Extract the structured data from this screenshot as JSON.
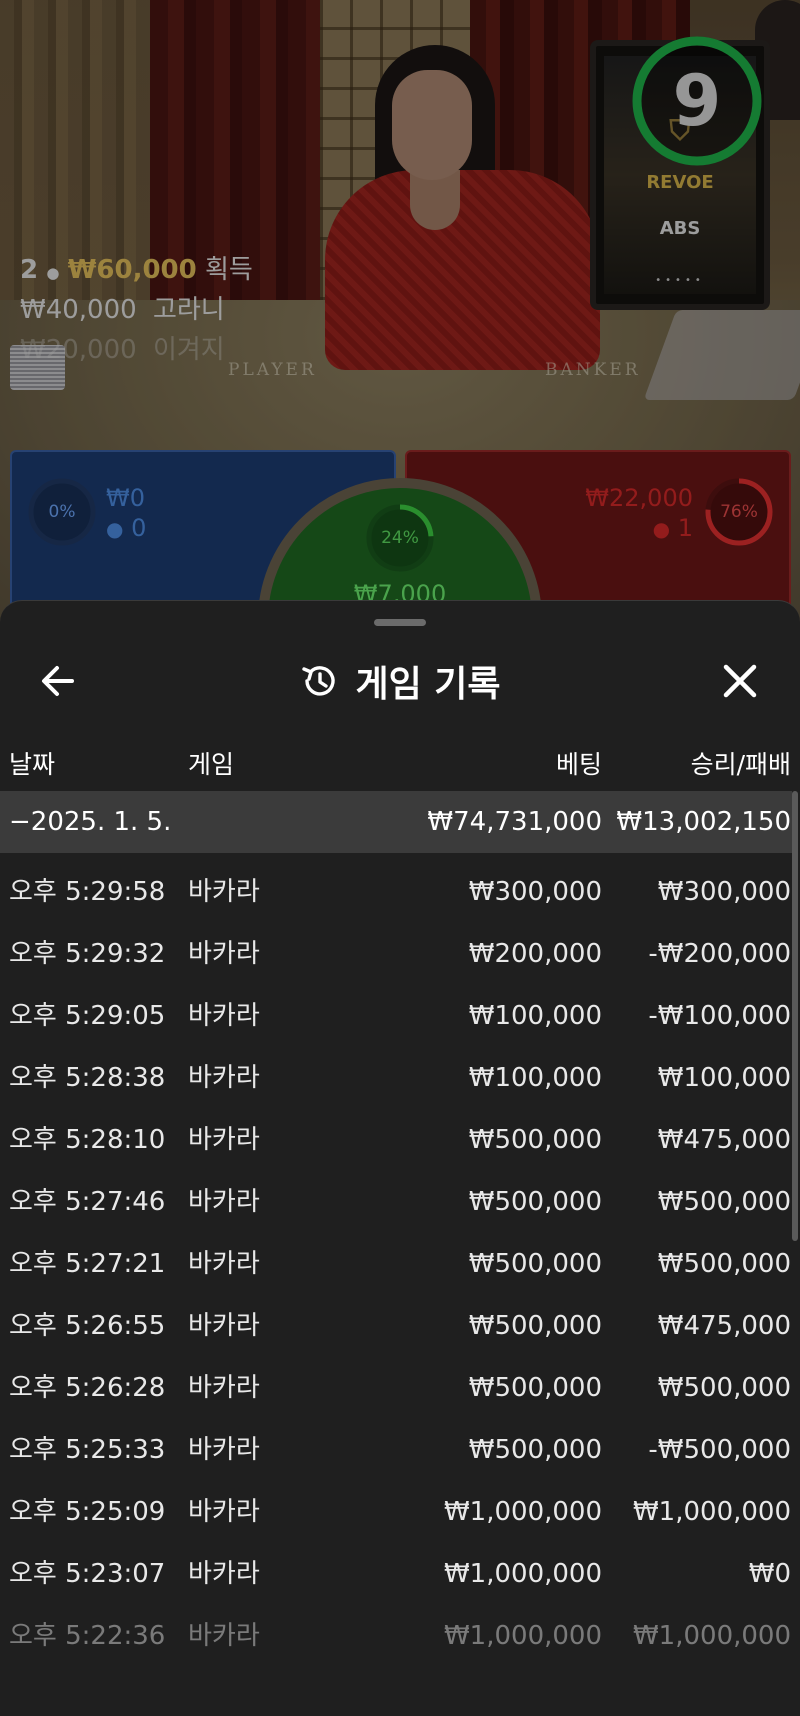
{
  "live": {
    "timer": "9",
    "ticker": [
      {
        "count": "2",
        "amount": "₩60,000",
        "action": "획득"
      },
      {
        "amount": "₩40,000",
        "name": "고라니"
      },
      {
        "amount": "₩20,000",
        "name": "이겨지"
      }
    ],
    "table_labels": {
      "player": "PLAYER",
      "banker": "BANKER"
    },
    "monitor_logos": [
      "REVOE",
      "ABS"
    ],
    "player_spot": {
      "percent": "0%",
      "amount": "₩0",
      "players": "0",
      "fill": 0
    },
    "tie_spot": {
      "percent": "24%",
      "amount": "₩7,000",
      "fill": 0.24
    },
    "banker_spot": {
      "percent": "76%",
      "amount": "₩22,000",
      "players": "1",
      "fill": 0.76
    },
    "colors": {
      "player": "#1d3d74",
      "banker": "#6e1717",
      "tie": "#1f6a22",
      "timer": "#1fb54a",
      "gold": "#e6c15c"
    }
  },
  "history": {
    "title": "게임 기록",
    "icons": {
      "back": "arrow-left-icon",
      "title": "history-icon",
      "close": "close-icon"
    },
    "columns": {
      "date": "날짜",
      "game": "게임",
      "bet": "베팅",
      "result": "승리/패배"
    },
    "group": {
      "date": "−2025. 1. 5.",
      "bet": "₩74,731,000",
      "result": "₩13,002,150"
    },
    "rows": [
      {
        "time": "오후 5:29:58",
        "game": "바카라",
        "bet": "₩300,000",
        "result": "₩300,000"
      },
      {
        "time": "오후 5:29:32",
        "game": "바카라",
        "bet": "₩200,000",
        "result": "-₩200,000"
      },
      {
        "time": "오후 5:29:05",
        "game": "바카라",
        "bet": "₩100,000",
        "result": "-₩100,000"
      },
      {
        "time": "오후 5:28:38",
        "game": "바카라",
        "bet": "₩100,000",
        "result": "₩100,000"
      },
      {
        "time": "오후 5:28:10",
        "game": "바카라",
        "bet": "₩500,000",
        "result": "₩475,000"
      },
      {
        "time": "오후 5:27:46",
        "game": "바카라",
        "bet": "₩500,000",
        "result": "₩500,000"
      },
      {
        "time": "오후 5:27:21",
        "game": "바카라",
        "bet": "₩500,000",
        "result": "₩500,000"
      },
      {
        "time": "오후 5:26:55",
        "game": "바카라",
        "bet": "₩500,000",
        "result": "₩475,000"
      },
      {
        "time": "오후 5:26:28",
        "game": "바카라",
        "bet": "₩500,000",
        "result": "₩500,000"
      },
      {
        "time": "오후 5:25:33",
        "game": "바카라",
        "bet": "₩500,000",
        "result": "-₩500,000"
      },
      {
        "time": "오후 5:25:09",
        "game": "바카라",
        "bet": "₩1,000,000",
        "result": "₩1,000,000"
      },
      {
        "time": "오후 5:23:07",
        "game": "바카라",
        "bet": "₩1,000,000",
        "result": "₩0"
      },
      {
        "time": "오후 5:22:36",
        "game": "바카라",
        "bet": "₩1,000,000",
        "result": "₩1,000,000"
      }
    ]
  }
}
